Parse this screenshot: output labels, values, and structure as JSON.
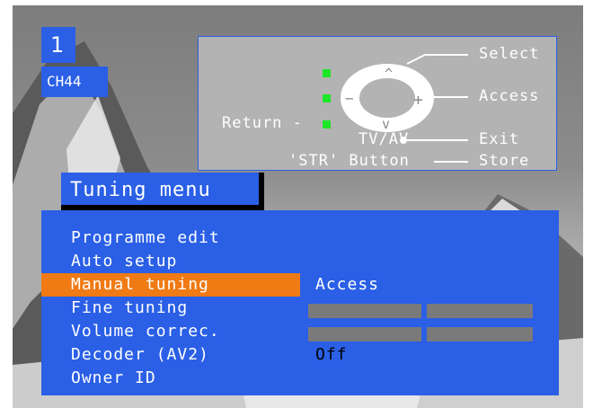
{
  "programme": {
    "number": "1",
    "channel": "CH44"
  },
  "help": {
    "select": "Select",
    "access": "Access",
    "return": "Return -",
    "tvav": "TV/AV",
    "exit": "Exit",
    "str_button": "'STR' Button",
    "store": "Store"
  },
  "menu": {
    "title": "Tuning menu",
    "items": [
      {
        "label": "Programme edit"
      },
      {
        "label": "Auto setup"
      },
      {
        "label": "Manual tuning",
        "value": "Access"
      },
      {
        "label": "Fine tuning"
      },
      {
        "label": "Volume correc."
      },
      {
        "label": "Decoder (AV2)",
        "value": "Off"
      },
      {
        "label": "Owner ID"
      }
    ],
    "selected_index": 2
  },
  "colors": {
    "menu_blue": "#2a5fe6",
    "highlight_orange": "#f07a14",
    "indicator_green": "#1ee628"
  }
}
